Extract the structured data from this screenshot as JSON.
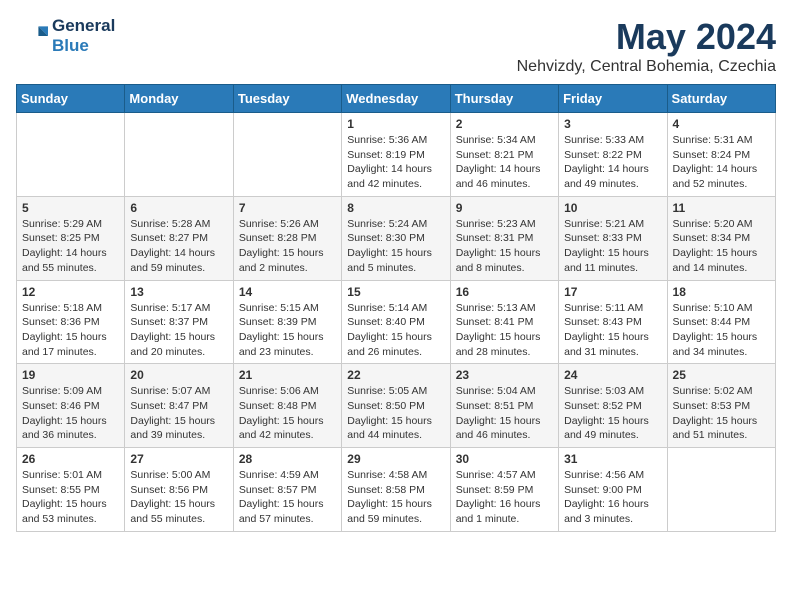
{
  "header": {
    "logo_line1": "General",
    "logo_line2": "Blue",
    "month": "May 2024",
    "location": "Nehvizdy, Central Bohemia, Czechia"
  },
  "days_of_week": [
    "Sunday",
    "Monday",
    "Tuesday",
    "Wednesday",
    "Thursday",
    "Friday",
    "Saturday"
  ],
  "weeks": [
    [
      {
        "day": "",
        "info": ""
      },
      {
        "day": "",
        "info": ""
      },
      {
        "day": "",
        "info": ""
      },
      {
        "day": "1",
        "info": "Sunrise: 5:36 AM\nSunset: 8:19 PM\nDaylight: 14 hours\nand 42 minutes."
      },
      {
        "day": "2",
        "info": "Sunrise: 5:34 AM\nSunset: 8:21 PM\nDaylight: 14 hours\nand 46 minutes."
      },
      {
        "day": "3",
        "info": "Sunrise: 5:33 AM\nSunset: 8:22 PM\nDaylight: 14 hours\nand 49 minutes."
      },
      {
        "day": "4",
        "info": "Sunrise: 5:31 AM\nSunset: 8:24 PM\nDaylight: 14 hours\nand 52 minutes."
      }
    ],
    [
      {
        "day": "5",
        "info": "Sunrise: 5:29 AM\nSunset: 8:25 PM\nDaylight: 14 hours\nand 55 minutes."
      },
      {
        "day": "6",
        "info": "Sunrise: 5:28 AM\nSunset: 8:27 PM\nDaylight: 14 hours\nand 59 minutes."
      },
      {
        "day": "7",
        "info": "Sunrise: 5:26 AM\nSunset: 8:28 PM\nDaylight: 15 hours\nand 2 minutes."
      },
      {
        "day": "8",
        "info": "Sunrise: 5:24 AM\nSunset: 8:30 PM\nDaylight: 15 hours\nand 5 minutes."
      },
      {
        "day": "9",
        "info": "Sunrise: 5:23 AM\nSunset: 8:31 PM\nDaylight: 15 hours\nand 8 minutes."
      },
      {
        "day": "10",
        "info": "Sunrise: 5:21 AM\nSunset: 8:33 PM\nDaylight: 15 hours\nand 11 minutes."
      },
      {
        "day": "11",
        "info": "Sunrise: 5:20 AM\nSunset: 8:34 PM\nDaylight: 15 hours\nand 14 minutes."
      }
    ],
    [
      {
        "day": "12",
        "info": "Sunrise: 5:18 AM\nSunset: 8:36 PM\nDaylight: 15 hours\nand 17 minutes."
      },
      {
        "day": "13",
        "info": "Sunrise: 5:17 AM\nSunset: 8:37 PM\nDaylight: 15 hours\nand 20 minutes."
      },
      {
        "day": "14",
        "info": "Sunrise: 5:15 AM\nSunset: 8:39 PM\nDaylight: 15 hours\nand 23 minutes."
      },
      {
        "day": "15",
        "info": "Sunrise: 5:14 AM\nSunset: 8:40 PM\nDaylight: 15 hours\nand 26 minutes."
      },
      {
        "day": "16",
        "info": "Sunrise: 5:13 AM\nSunset: 8:41 PM\nDaylight: 15 hours\nand 28 minutes."
      },
      {
        "day": "17",
        "info": "Sunrise: 5:11 AM\nSunset: 8:43 PM\nDaylight: 15 hours\nand 31 minutes."
      },
      {
        "day": "18",
        "info": "Sunrise: 5:10 AM\nSunset: 8:44 PM\nDaylight: 15 hours\nand 34 minutes."
      }
    ],
    [
      {
        "day": "19",
        "info": "Sunrise: 5:09 AM\nSunset: 8:46 PM\nDaylight: 15 hours\nand 36 minutes."
      },
      {
        "day": "20",
        "info": "Sunrise: 5:07 AM\nSunset: 8:47 PM\nDaylight: 15 hours\nand 39 minutes."
      },
      {
        "day": "21",
        "info": "Sunrise: 5:06 AM\nSunset: 8:48 PM\nDaylight: 15 hours\nand 42 minutes."
      },
      {
        "day": "22",
        "info": "Sunrise: 5:05 AM\nSunset: 8:50 PM\nDaylight: 15 hours\nand 44 minutes."
      },
      {
        "day": "23",
        "info": "Sunrise: 5:04 AM\nSunset: 8:51 PM\nDaylight: 15 hours\nand 46 minutes."
      },
      {
        "day": "24",
        "info": "Sunrise: 5:03 AM\nSunset: 8:52 PM\nDaylight: 15 hours\nand 49 minutes."
      },
      {
        "day": "25",
        "info": "Sunrise: 5:02 AM\nSunset: 8:53 PM\nDaylight: 15 hours\nand 51 minutes."
      }
    ],
    [
      {
        "day": "26",
        "info": "Sunrise: 5:01 AM\nSunset: 8:55 PM\nDaylight: 15 hours\nand 53 minutes."
      },
      {
        "day": "27",
        "info": "Sunrise: 5:00 AM\nSunset: 8:56 PM\nDaylight: 15 hours\nand 55 minutes."
      },
      {
        "day": "28",
        "info": "Sunrise: 4:59 AM\nSunset: 8:57 PM\nDaylight: 15 hours\nand 57 minutes."
      },
      {
        "day": "29",
        "info": "Sunrise: 4:58 AM\nSunset: 8:58 PM\nDaylight: 15 hours\nand 59 minutes."
      },
      {
        "day": "30",
        "info": "Sunrise: 4:57 AM\nSunset: 8:59 PM\nDaylight: 16 hours\nand 1 minute."
      },
      {
        "day": "31",
        "info": "Sunrise: 4:56 AM\nSunset: 9:00 PM\nDaylight: 16 hours\nand 3 minutes."
      },
      {
        "day": "",
        "info": ""
      }
    ]
  ]
}
